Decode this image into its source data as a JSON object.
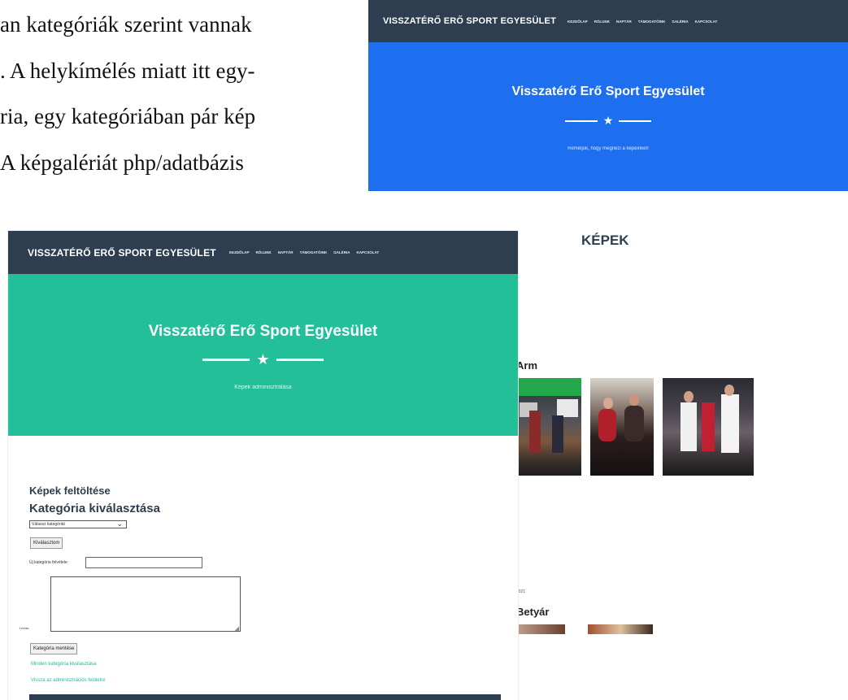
{
  "document": {
    "lines": [
      "an kategóriák szerint vannak",
      ". A helykímélés miatt itt egy-",
      "ria, egy kategóriában pár kép",
      "A képgalériát php/adatbázis"
    ]
  },
  "screenshot_blue": {
    "brand": "VISSZATÉRŐ ERŐ SPORT EGYESÜLET",
    "menu": [
      "Kezdőlap",
      "Rólunk",
      "Naptár",
      "Támogatóink",
      "Galéria",
      "Kapcsolat"
    ],
    "hero_title": "Visszatérő Erő Sport Egyesület",
    "hero_subtitle": "Reméljük, hogy megnézi a képeinket!",
    "section_title": "KÉPEK",
    "category_1": "Arm",
    "date_text": "2021",
    "category_2": "Betyár",
    "colors": {
      "nav": "#2c3e50",
      "hero": "#1e6ff0"
    }
  },
  "screenshot_green": {
    "brand": "VISSZATÉRŐ ERŐ SPORT EGYESÜLET",
    "menu": [
      "Kezdőlap",
      "Rólunk",
      "Naptár",
      "Támogatóink",
      "Galéria",
      "Kapcsolat"
    ],
    "hero_title": "Visszatérő Erő Sport Egyesület",
    "hero_subtitle": "Képek adminisztrálása",
    "upload_heading": "Képek feltöltése",
    "category_heading": "Kategória kiválasztása",
    "select_value": "Válassz kategóriát",
    "select_button": "Kiválasztom",
    "new_category_label": "Új kategória felvétele:",
    "description_label": "Leírás:",
    "insert_button": "Kategória mentése",
    "link_1": "Minden kategória kiválasztása",
    "link_2": "Vissza az adminisztrációs felületre",
    "colors": {
      "nav": "#2c3e50",
      "hero": "#22bf98"
    }
  }
}
